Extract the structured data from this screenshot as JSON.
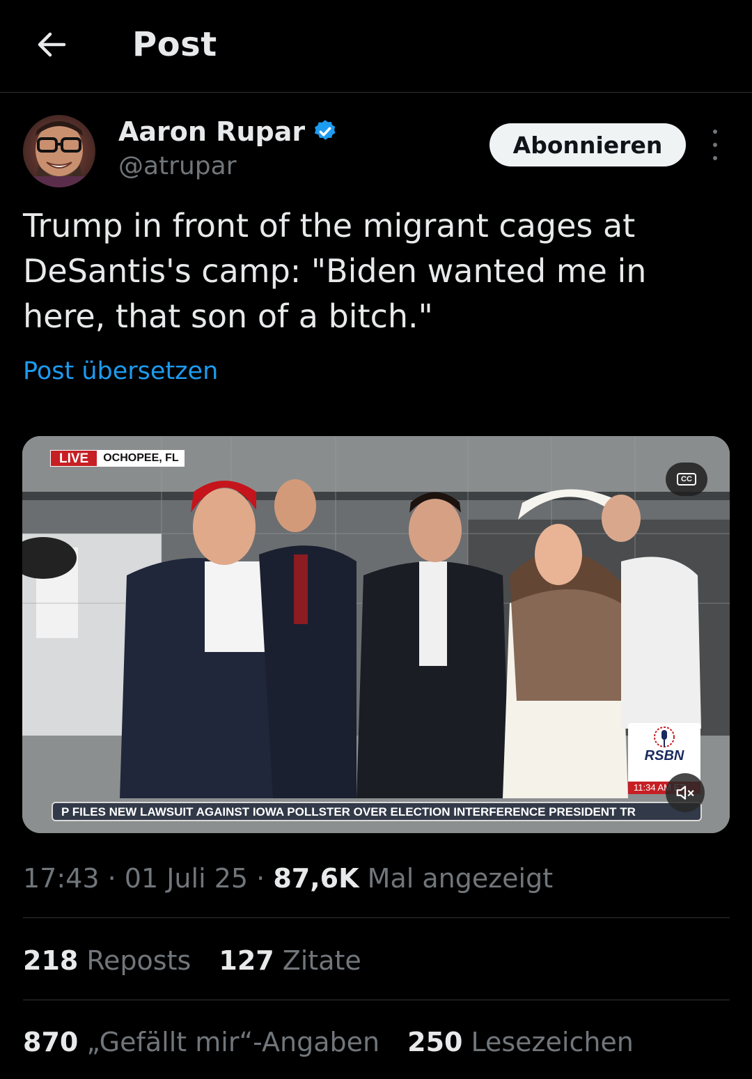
{
  "header": {
    "title": "Post",
    "back_icon": "arrow-left-icon"
  },
  "author": {
    "name": "Aaron Rupar",
    "handle": "@atrupar",
    "verified": true,
    "verified_color": "#1d9bf0"
  },
  "follow_button": {
    "label": "Abonnieren"
  },
  "post": {
    "text": "Trump in front of the migrant cages at DeSantis's camp: \"Biden wanted me in here, that son of a bitch.\"",
    "translate_label": "Post übersetzen"
  },
  "video": {
    "live_label": "LIVE",
    "location": "OCHOPEE, FL",
    "cc_label": "CC",
    "ticker": "P FILES NEW LAWSUIT AGAINST IOWA POLLSTER OVER ELECTION INTERFERENCE     PRESIDENT TR",
    "network": "RSBN",
    "network_time": "11:34 AM ET",
    "muted": true
  },
  "meta": {
    "time": "17:43",
    "sep1": "·",
    "date": "01 Juli 25",
    "sep2": "·",
    "views": "87,6K",
    "views_label": "Mal angezeigt"
  },
  "stats": {
    "reposts": {
      "count": "218",
      "label": "Reposts"
    },
    "quotes": {
      "count": "127",
      "label": "Zitate"
    },
    "likes": {
      "count": "870",
      "label": "„Gefällt mir“-Angaben"
    },
    "bookmarks": {
      "count": "250",
      "label": "Lesezeichen"
    }
  },
  "colors": {
    "accent": "#1d9bf0",
    "background": "#000000",
    "secondary_text": "#71767b",
    "live_red": "#c61f24"
  }
}
